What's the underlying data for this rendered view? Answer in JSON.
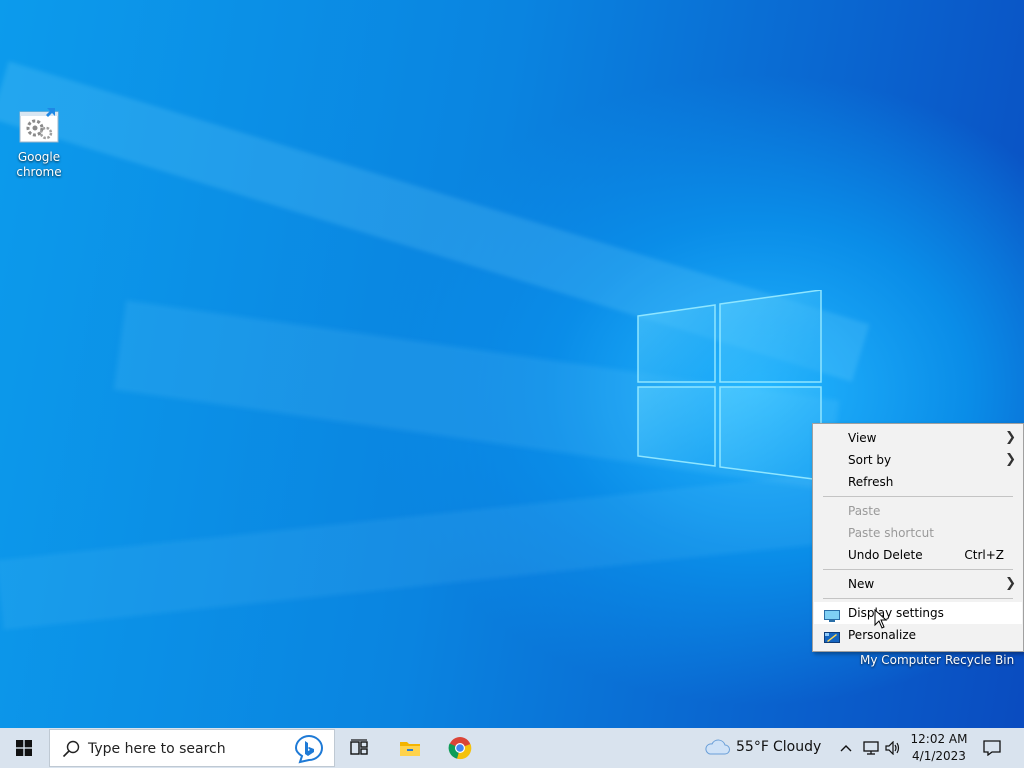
{
  "desktop": {
    "icons": [
      {
        "label_line1": "Google",
        "label_line2": "chrome",
        "icon": "settings-shortcut-icon"
      }
    ],
    "hidden_icon_labels": [
      "My Computer",
      "Recycle Bin"
    ]
  },
  "context_menu": {
    "items": [
      {
        "label": "View",
        "has_submenu": true,
        "enabled": true
      },
      {
        "label": "Sort by",
        "has_submenu": true,
        "enabled": true
      },
      {
        "label": "Refresh",
        "has_submenu": false,
        "enabled": true
      },
      {
        "label": "Paste",
        "has_submenu": false,
        "enabled": false
      },
      {
        "label": "Paste shortcut",
        "has_submenu": false,
        "enabled": false
      },
      {
        "label": "Undo Delete",
        "shortcut": "Ctrl+Z",
        "has_submenu": false,
        "enabled": true
      },
      {
        "label": "New",
        "has_submenu": true,
        "enabled": true
      },
      {
        "label": "Display settings",
        "icon": "display-icon",
        "enabled": true,
        "highlighted": true
      },
      {
        "label": "Personalize",
        "icon": "personalize-icon",
        "enabled": true
      }
    ]
  },
  "taskbar": {
    "search_placeholder": "Type here to search",
    "weather": {
      "temp": "55°F",
      "condition": "Cloudy"
    },
    "clock": {
      "time": "12:02 AM",
      "date": "4/1/2023"
    },
    "pinned": [
      "task-view-icon",
      "file-explorer-icon",
      "chrome-icon"
    ],
    "tray": [
      "chevron-up-icon",
      "network-icon",
      "volume-icon",
      "notification-icon"
    ]
  },
  "colors": {
    "accent": "#0078d7",
    "taskbar": "#d9e3ee",
    "menu": "#f2f2f2"
  }
}
